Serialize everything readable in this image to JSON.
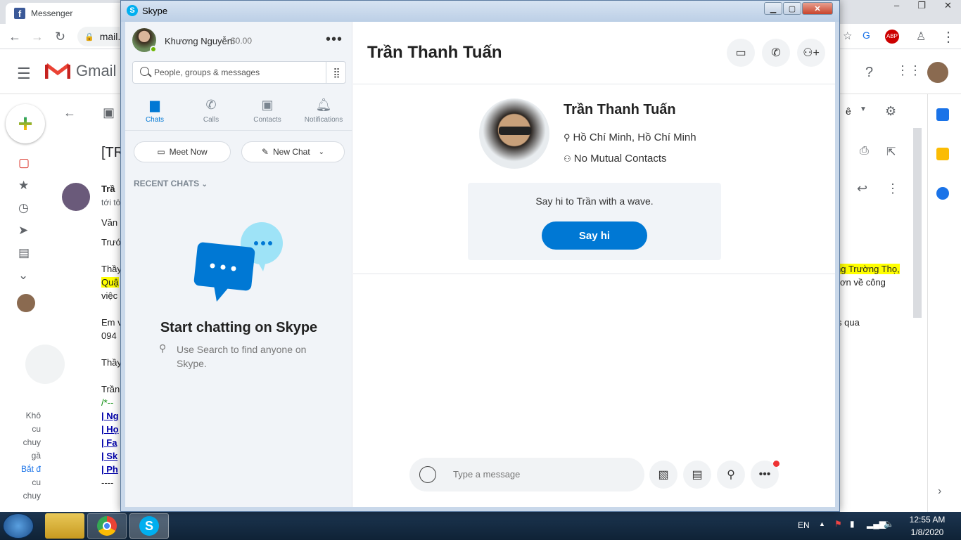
{
  "chrome": {
    "tab_title": "Messenger",
    "omnibox_text": "mail."
  },
  "gmail": {
    "logo_text": "Gmail",
    "subject_fragment": "[TR",
    "sender_fragment": "Trầ",
    "to_fragment": "tới tô",
    "lines": [
      "Văn",
      "Trướ",
      "Thầy",
      "Quậ",
      "việc",
      "Em v",
      "094",
      "Thầy",
      "Trần",
      "/*--",
      "| Ng",
      "| Họ",
      "| Fa",
      "| Sk",
      "| Ph",
      "----"
    ],
    "right_lines": [
      "ng Trường Thọ,",
      "ơn về công",
      "s qua"
    ],
    "side_text": [
      "Khô",
      "cu",
      "chuy",
      "gầ",
      "Bắt đ",
      "cu",
      "chuy"
    ],
    "label_fragment": "ê"
  },
  "skype": {
    "window_title": "Skype",
    "profile": {
      "name": "Khương Nguyễn",
      "credit": "$0.00"
    },
    "search_placeholder": "People, groups & messages",
    "tabs": [
      {
        "label": "Chats",
        "icon": "chat-icon"
      },
      {
        "label": "Calls",
        "icon": "phone-icon"
      },
      {
        "label": "Contacts",
        "icon": "contacts-icon"
      },
      {
        "label": "Notifications",
        "icon": "bell-icon"
      }
    ],
    "meet_now_label": "Meet Now",
    "new_chat_label": "New Chat",
    "recent_chats_label": "RECENT CHATS",
    "empty_title": "Start chatting on Skype",
    "empty_subtitle": "Use Search to find anyone on Skype.",
    "contact": {
      "name": "Trần Thanh Tuấn",
      "location": "Hồ Chí Minh, Hồ Chí Minh",
      "mutual": "No Mutual Contacts"
    },
    "wave_text": "Say hi to Trần with a wave.",
    "say_hi_label": "Say hi",
    "message_placeholder": "Type a message",
    "accent_color": "#0078d4"
  },
  "taskbar": {
    "language": "EN",
    "time": "12:55 AM",
    "date": "1/8/2020"
  }
}
